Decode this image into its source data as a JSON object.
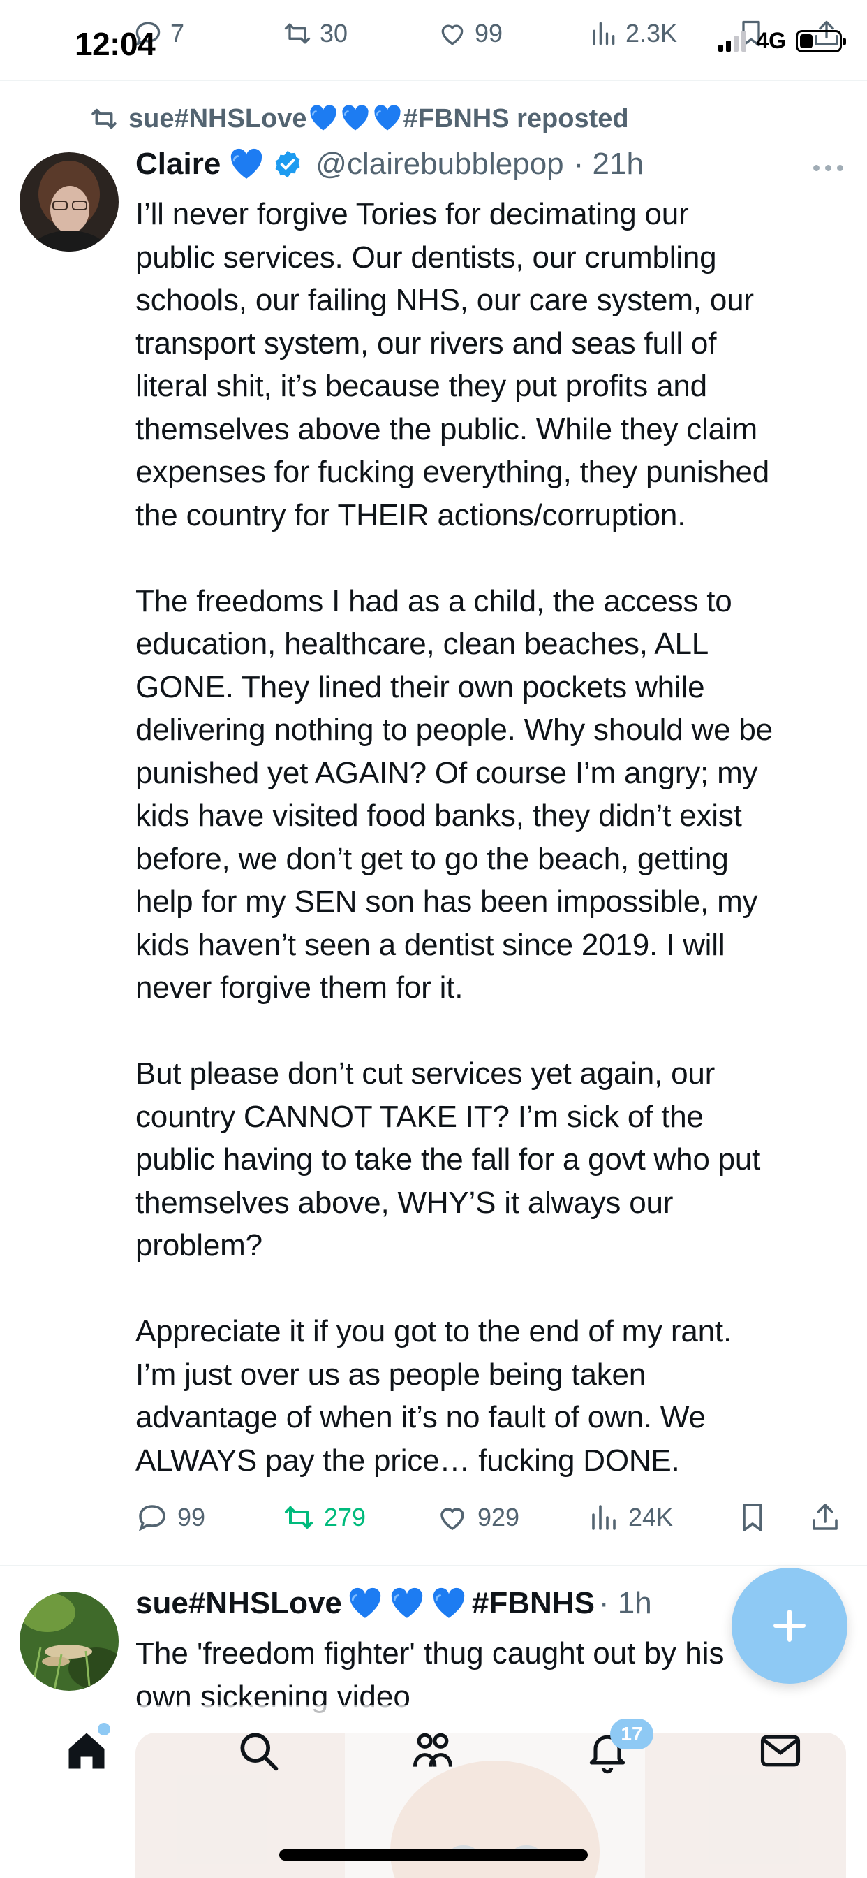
{
  "status_bar": {
    "time": "12:04",
    "network": "4G"
  },
  "previous_tweet_actions": {
    "replies": "7",
    "reposts": "30",
    "likes": "99",
    "views": "2.3K"
  },
  "repost_banner": {
    "user_prefix": "sue#NHSLove",
    "user_suffix": "#FBNHS reposted"
  },
  "tweet": {
    "author_name": "Claire",
    "handle": "@clairebubblepop",
    "time": "· 21h",
    "text": "I’ll never forgive Tories for decimating our\npublic services. Our dentists, our crumbling\nschools, our failing NHS, our care system, our\ntransport system, our rivers and seas full of\nliteral shit, it’s because they put profits and\nthemselves above the public. While they claim\nexpenses for fucking everything, they punished\nthe country for THEIR actions/corruption.\n\nThe freedoms I had as a child, the access to\neducation, healthcare, clean beaches, ALL\nGONE. They lined their own pockets while\ndelivering nothing to people. Why should we be\npunished yet AGAIN? Of course I’m angry; my\nkids have visited food banks, they didn’t exist\nbefore, we don’t get to go the beach, getting\nhelp for my SEN son has been impossible, my\nkids haven’t seen a dentist since 2019. I will\nnever forgive them for it.\n\nBut please don’t cut services yet again, our\ncountry CANNOT TAKE IT? I’m sick of the\npublic having to take the fall for a govt who put\nthemselves above, WHY’S it always our\nproblem?\n\nAppreciate it if you got to the end of my rant.\nI’m just over us as people being taken\nadvantage of when it’s no fault of own. We\nALWAYS pay the price… fucking DONE.",
    "replies": "99",
    "reposts": "279",
    "likes": "929",
    "views": "24K"
  },
  "next_tweet": {
    "author_prefix": "sue#NHSLove",
    "author_suffix": "#FBNHS",
    "time": "· 1h",
    "text": "The 'freedom fighter' thug caught out by his\nown sickening video"
  },
  "tab_bar": {
    "notifications_badge": "17"
  },
  "colors": {
    "accent": "#1d9bf0",
    "repost_green": "#00ba7c",
    "muted": "#536471",
    "heart_blue": "#1d9bf0",
    "fab": "#8ec9f4"
  }
}
